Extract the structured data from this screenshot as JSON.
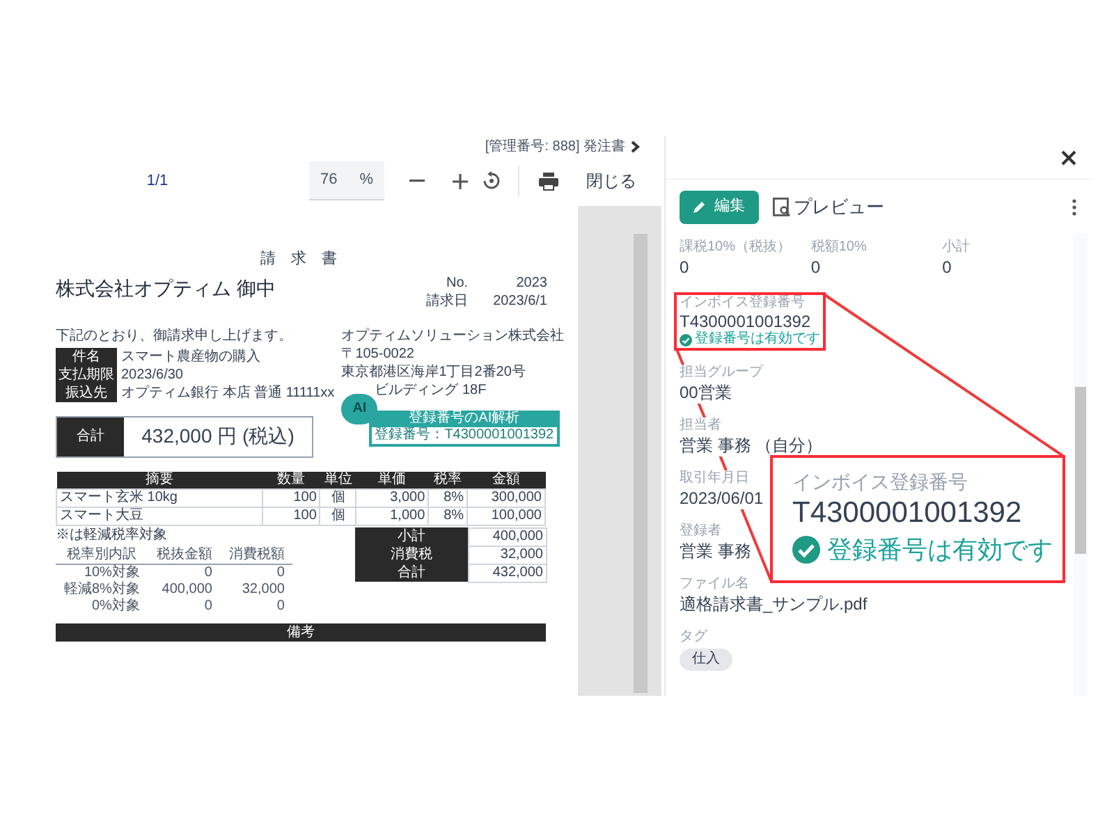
{
  "viewer": {
    "breadcrumb": "[管理番号: 888] 発注書",
    "page": "1/1",
    "zoom": "76",
    "zoom_unit": "%",
    "close": "閉じる"
  },
  "document": {
    "title": "請 求 書",
    "recipient": "株式会社オプティム 御中",
    "meta": [
      {
        "label": "No.",
        "value": "2023"
      },
      {
        "label": "請求日",
        "value": "2023/6/1"
      }
    ],
    "greeting": "下記のとおり、御請求申し上げます。",
    "details": [
      {
        "label": "件名",
        "value": "スマート農産物の購入"
      },
      {
        "label": "支払期限",
        "value": "2023/6/30"
      },
      {
        "label": "振込先",
        "value": "オプティム銀行 本店 普通 11111xx"
      }
    ],
    "issuer": [
      "オプティムソリューション株式会社",
      "〒105-0022",
      "東京都港区海岸1丁目2番20号",
      "ビルディング 18F"
    ],
    "ai_badge": {
      "icon_text": "AI",
      "title": "登録番号のAI解析",
      "result": "登録番号：T4300001001392"
    },
    "total": {
      "label": "合計",
      "value": "432,000 円 (税込)"
    },
    "table": {
      "columns": [
        "摘要",
        "数量",
        "単位",
        "単価",
        "税率",
        "金額"
      ],
      "rows": [
        [
          "スマート玄米 10kg",
          "100",
          "個",
          "3,000",
          "8%",
          "300,000"
        ],
        [
          "スマート大豆",
          "100",
          "個",
          "1,000",
          "8%",
          "100,000"
        ]
      ]
    },
    "note": "※は軽減税率対象",
    "breakdown": {
      "columns": [
        "税率別内訳",
        "税抜金額",
        "消費税額"
      ],
      "rows": [
        [
          "10%対象",
          "0",
          "0"
        ],
        [
          "軽減8%対象",
          "400,000",
          "32,000"
        ],
        [
          "0%対象",
          "0",
          "0"
        ]
      ]
    },
    "summary": [
      {
        "label": "小計",
        "value": "400,000"
      },
      {
        "label": "消費税",
        "value": "32,000"
      },
      {
        "label": "合計",
        "value": "432,000"
      }
    ],
    "remarks": "備考"
  },
  "panel": {
    "edit": "編集",
    "preview": "プレビュー",
    "amounts": [
      {
        "label": "課税10%（税抜）",
        "value": "0"
      },
      {
        "label": "税額10%",
        "value": "0"
      },
      {
        "label": "小計",
        "value": "0"
      }
    ],
    "fields": [
      {
        "kind": "invoice",
        "label": "インボイス登録番号",
        "value": "T4300001001392",
        "status": "登録番号は有効です",
        "valid": true
      },
      {
        "kind": "text",
        "label": "担当グループ",
        "value": "00営業"
      },
      {
        "kind": "text",
        "label": "担当者",
        "value": "営業 事務 （自分）"
      },
      {
        "kind": "text",
        "label": "取引年月日",
        "value": "2023/06/01"
      },
      {
        "kind": "text",
        "label": "登録者",
        "value": "営業 事務"
      },
      {
        "kind": "text",
        "label": "ファイル名",
        "value": "適格請求書_サンプル.pdf"
      },
      {
        "kind": "tags",
        "label": "タグ",
        "tags": [
          "仕入"
        ]
      }
    ]
  },
  "callout": {
    "label": "インボイス登録番号",
    "value": "T4300001001392",
    "status": "登録番号は有効です",
    "valid": true
  }
}
